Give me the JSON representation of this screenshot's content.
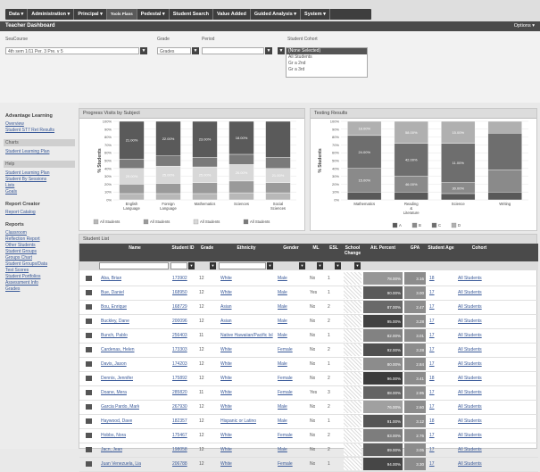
{
  "nav": {
    "items": [
      "Data ▾",
      "Administration ▾",
      "Principal ▾",
      "Tools Plans",
      "Pedestal ▾",
      "Student Search",
      "Value Added",
      "Guided Analysis ▾",
      "System ▾"
    ]
  },
  "titlebar": {
    "title": "Teacher Dashboard",
    "options": "Options ▾"
  },
  "filters": {
    "school_label": "SeaCourse",
    "school_value": "4th sem 1/11 Per. 3 Pre. v 5",
    "grade_label": "Grade",
    "grade_value": "Grades",
    "period_label": "Period",
    "period_value": "",
    "cohort_label": "Student Cohort",
    "cohort_options": [
      "(None Selected)",
      "All Students",
      "Gr a 2nd",
      "Gr a 3rd"
    ]
  },
  "leftnav": {
    "sections": [
      {
        "head": "Advantage Learning",
        "links": [
          "Overview",
          "Student ST7 Ret Results"
        ]
      },
      {
        "head": "",
        "selected": "Charts",
        "links": [
          "Student Learning Plan"
        ]
      },
      {
        "head": "",
        "selected": "Help",
        "links": [
          "Student Learning Plan",
          "Student By Sessions",
          "Lists",
          "Goals"
        ]
      },
      {
        "head": "Report Creator",
        "links": [
          "Report Catalog"
        ]
      },
      {
        "head": "Reports",
        "links": [
          "Classroom",
          "Reflection Report",
          "Other Students",
          "Student Groups",
          "Groups Chart",
          "Student Groups/Data",
          "Test Scores",
          "Student Portfolios",
          "Assessment Info",
          "Grades"
        ]
      }
    ]
  },
  "progress_chart": {
    "title": "Progress Visits by Subject"
  },
  "testing_chart": {
    "title": "Testing Results"
  },
  "chart_data": [
    {
      "type": "bar",
      "title": "Progress Visits by Subject",
      "ylabel": "% Students",
      "ylim": [
        0,
        100
      ],
      "categories": [
        "English Language",
        "Foreign Language",
        "Mathematics",
        "Sciences",
        "Social Sciences"
      ],
      "series": [
        {
          "name": "All Students",
          "values": [
            8,
            8,
            8,
            9,
            9
          ]
        },
        {
          "name": "All Students",
          "values": [
            12,
            13,
            14,
            15,
            13
          ]
        },
        {
          "name": "All Students",
          "values": [
            20,
            22,
            20,
            21,
            18
          ]
        },
        {
          "name": "All Students",
          "values": [
            12,
            13,
            12,
            13,
            14
          ]
        },
        {
          "name": "All Students",
          "values": [
            48,
            44,
            46,
            42,
            46
          ]
        }
      ],
      "labels": [
        "29.00%",
        "21.00%",
        "25.00%",
        "22.00%",
        "25.00%",
        "23.00%",
        "26.00%",
        "18.00%",
        "21.00%"
      ],
      "legend": [
        "All Students",
        "All Students",
        "All Students",
        "All Students"
      ]
    },
    {
      "type": "bar",
      "title": "Testing Results",
      "ylabel": "% Students",
      "ylim": [
        0,
        100
      ],
      "categories": [
        "Mathematics",
        "Reading & Literature",
        "Science",
        "Writing"
      ],
      "series": [
        {
          "name": "A",
          "values": [
            10,
            10,
            8,
            10
          ]
        },
        {
          "name": "B",
          "values": [
            30,
            20,
            14,
            28
          ]
        },
        {
          "name": "C",
          "values": [
            42,
            42,
            50,
            47
          ]
        },
        {
          "name": "D",
          "values": [
            18,
            28,
            28,
            15
          ]
        }
      ],
      "labels": [
        "15.00%",
        "24.00%",
        "18.00%",
        "46.00%",
        "42.00%",
        "58.00%",
        "30.00%",
        "11.00%",
        "15.00%"
      ],
      "legend": [
        "A",
        "B",
        "C",
        "D"
      ]
    }
  ],
  "table": {
    "title": "Student List",
    "headers": [
      "Name",
      "Student ID",
      "Grade",
      "Ethnicity",
      "Gender",
      "ML",
      "ESL",
      "School Change",
      "Att. Percent",
      "GPA",
      "Student Age",
      "Cohort"
    ],
    "rows": [
      [
        "Aba, Brian",
        "173902",
        "12",
        "White",
        "Male",
        "No",
        "1",
        "78.00%",
        "3.16",
        "18",
        "All Students"
      ],
      [
        "Bue, Daniel",
        "168950",
        "12",
        "White",
        "Male",
        "Yes",
        "1",
        "90.00%",
        "3.00",
        "17",
        "All Students"
      ],
      [
        "Bou, Enrique",
        "168729",
        "12",
        "Asian",
        "Male",
        "No",
        "2",
        "87.00%",
        "2.47",
        "17",
        "All Students"
      ],
      [
        "Buckley, Dane",
        "200096",
        "12",
        "Asian",
        "Male",
        "No",
        "2",
        "95.00%",
        "3.28",
        "17",
        "All Students"
      ],
      [
        "Bunch, Pablo",
        "256403",
        "11",
        "Native Hawaiian/Pacific Isl",
        "Male",
        "No",
        "1",
        "82.00%",
        "3.01",
        "17",
        "All Students"
      ],
      [
        "Cardenas, Helen",
        "173303",
        "12",
        "White",
        "Female",
        "No",
        "2",
        "92.00%",
        "3.28",
        "17",
        "All Students"
      ],
      [
        "Davis, Jason",
        "174203",
        "12",
        "White",
        "Male",
        "No",
        "1",
        "80.00%",
        "2.84",
        "17",
        "All Students"
      ],
      [
        "Dennis, Jennifer",
        "175892",
        "12",
        "White",
        "Female",
        "No",
        "2",
        "96.00%",
        "3.41",
        "18",
        "All Students"
      ],
      [
        "Doane, Mera",
        "285820",
        "11",
        "White",
        "Female",
        "Yes",
        "3",
        "88.00%",
        "2.95",
        "17",
        "All Students"
      ],
      [
        "Garcia Pardo, Mark",
        "267930",
        "12",
        "White",
        "Male",
        "No",
        "2",
        "76.00%",
        "2.60",
        "17",
        "All Students"
      ],
      [
        "Haywood, Dave",
        "182357",
        "12",
        "Hispanic or Latino",
        "Male",
        "No",
        "1",
        "91.00%",
        "3.12",
        "18",
        "All Students"
      ],
      [
        "Hobbs, Nora",
        "175467",
        "12",
        "White",
        "Female",
        "No",
        "2",
        "83.00%",
        "2.76",
        "17",
        "All Students"
      ],
      [
        "Jacn, Jean",
        "198058",
        "12",
        "White",
        "Male",
        "No",
        "2",
        "89.00%",
        "3.05",
        "17",
        "All Students"
      ],
      [
        "Juan Venezuela, Lia",
        "206788",
        "12",
        "White",
        "Female",
        "No",
        "1",
        "94.00%",
        "3.30",
        "17",
        "All Students"
      ]
    ]
  }
}
